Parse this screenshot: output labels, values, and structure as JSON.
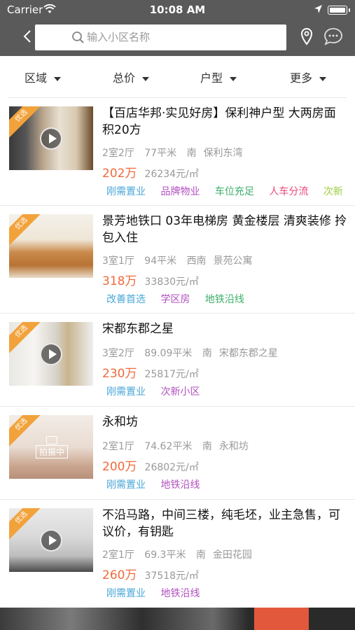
{
  "status_bar": {
    "carrier": "Carrier",
    "time": "10:08 AM"
  },
  "search": {
    "placeholder": "输入小区名称"
  },
  "filters": [
    {
      "label": "区域"
    },
    {
      "label": "总价"
    },
    {
      "label": "户型"
    },
    {
      "label": "更多"
    }
  ],
  "listings": [
    {
      "badge": "优选",
      "media": "video",
      "title": "【百店华邦·实见好房】保利神户型 大两房面积20方",
      "layout": "2室2厅",
      "area": "77平米",
      "direction": "南",
      "community": "保利东湾",
      "price": "202万",
      "unit_price": "26234元/㎡",
      "tags": [
        {
          "text": "刚需置业",
          "color": "#4aa7d8"
        },
        {
          "text": "品牌物业",
          "color": "#b24fc0"
        },
        {
          "text": "车位充足",
          "color": "#3cae6a"
        },
        {
          "text": "人车分流",
          "color": "#f0467a"
        },
        {
          "text": "次新",
          "color": "#9ccc3c"
        }
      ]
    },
    {
      "badge": "优选",
      "media": "photo",
      "title": "景芳地铁口 03年电梯房 黄金楼层 清爽装修 拎包入住",
      "layout": "3室1厅",
      "area": "94平米",
      "direction": "西南",
      "community": "景苑公寓",
      "price": "318万",
      "unit_price": "33830元/㎡",
      "tags": [
        {
          "text": "改善首选",
          "color": "#4aa7d8"
        },
        {
          "text": "学区房",
          "color": "#b24fc0"
        },
        {
          "text": "地铁沿线",
          "color": "#3cae6a"
        }
      ]
    },
    {
      "badge": "优选",
      "media": "video",
      "title": "宋都东郡之星",
      "layout": "3室2厅",
      "area": "89.09平米",
      "direction": "南",
      "community": "宋都东郡之星",
      "price": "230万",
      "unit_price": "25817元/㎡",
      "tags": [
        {
          "text": "刚需置业",
          "color": "#4aa7d8"
        },
        {
          "text": "次新小区",
          "color": "#b24fc0"
        }
      ]
    },
    {
      "badge": "优选",
      "media": "shooting",
      "shooting_label": "拍摄中",
      "title": "永和坊",
      "layout": "2室1厅",
      "area": "74.62平米",
      "direction": "南",
      "community": "永和坊",
      "price": "200万",
      "unit_price": "26802元/㎡",
      "tags": [
        {
          "text": "刚需置业",
          "color": "#4aa7d8"
        },
        {
          "text": "地铁沿线",
          "color": "#b24fc0"
        }
      ]
    },
    {
      "badge": "优选",
      "media": "video",
      "title": "不沿马路，中间三楼，纯毛坯，业主急售，可议价，有钥匙",
      "layout": "2室1厅",
      "area": "69.3平米",
      "direction": "南",
      "community": "金田花园",
      "price": "260万",
      "unit_price": "37518元/㎡",
      "tags": [
        {
          "text": "刚需置业",
          "color": "#4aa7d8"
        },
        {
          "text": "地铁沿线",
          "color": "#b24fc0"
        }
      ]
    }
  ]
}
